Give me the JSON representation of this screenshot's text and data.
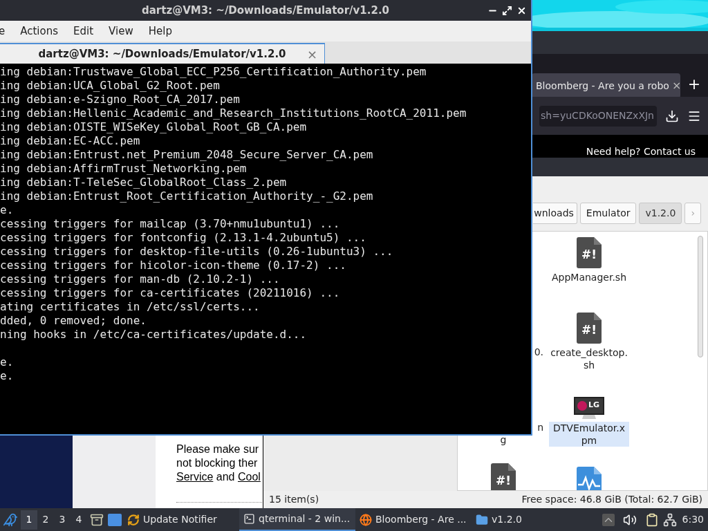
{
  "terminal": {
    "title": "dartz@VM3: ~/Downloads/Emulator/v1.2.0",
    "menu": [
      "e",
      "Actions",
      "Edit",
      "View",
      "Help"
    ],
    "tabs": [
      {
        "label": "dartz@VM3: ~/Downloads/Emulator/v1.2.0",
        "selected": true,
        "close": "×"
      }
    ],
    "blocks": [
      [
        "ing debian:Trustwave_Global_ECC_P256_Certification_Authority.pem",
        "ing debian:UCA_Global_G2_Root.pem",
        "ing debian:e-Szigno_Root_CA_2017.pem",
        "ing debian:Hellenic_Academic_and_Research_Institutions_RootCA_2011.pem",
        "ing debian:OISTE_WISeKey_Global_Root_GB_CA.pem",
        "ing debian:EC-ACC.pem",
        "ing debian:Entrust.net_Premium_2048_Secure_Server_CA.pem",
        "ing debian:AffirmTrust_Networking.pem",
        "ing debian:T-TeleSec_GlobalRoot_Class_2.pem",
        "ing debian:Entrust_Root_Certification_Authority_-_G2.pem",
        "e.",
        "cessing triggers for mailcap (3.70+nmu1ubuntu1) ...",
        "cessing triggers for fontconfig (2.13.1-4.2ubuntu5) ...",
        "cessing triggers for desktop-file-utils (0.26-1ubuntu3) ...",
        "cessing triggers for hicolor-icon-theme (0.17-2) ...",
        "cessing triggers for man-db (2.10.2-1) ...",
        "cessing triggers for ca-certificates (20211016) ...",
        "ating certificates in /etc/ssl/certs...",
        "dded, 0 removed; done.",
        "ning hooks in /etc/ca-certificates/update.d..."
      ],
      [
        "e.",
        "e."
      ]
    ]
  },
  "browser": {
    "tab": {
      "label": "Bloomberg - Are you a robo",
      "close": "×"
    },
    "new_tab": "+",
    "url": "sh=yuCDKoONENZxXJn",
    "banner": "Need help? Contact us",
    "page_lines": [
      [
        {
          "text": "Please make sur",
          "link": false
        }
      ],
      [
        {
          "text": "not blocking ther",
          "link": false
        }
      ],
      [
        {
          "text": "Service",
          "link": true
        },
        {
          "text": " and ",
          "link": false
        },
        {
          "text": "Cool",
          "link": true
        }
      ]
    ]
  },
  "file_manager": {
    "breadcrumbs": [
      {
        "label": "wnloads",
        "selected": false
      },
      {
        "label": "Emulator",
        "selected": false
      },
      {
        "label": "v1.2.0",
        "selected": true
      },
      {
        "label": "›",
        "selected": false
      }
    ],
    "rows": [
      {
        "right": {
          "kind": "script",
          "glyph": "#!",
          "label": "AppManager.sh",
          "selected": false
        }
      },
      {
        "left": {
          "label_lines": [
            "0."
          ]
        },
        "right": {
          "kind": "script",
          "glyph": "#!",
          "label": "create_desktop.sh",
          "selected": false
        }
      },
      {
        "left": {
          "label_lines": [
            "n",
            "g"
          ]
        },
        "right": {
          "kind": "tv",
          "logo": "LG",
          "label": "DTVEmulator.xpm",
          "selected": true
        }
      },
      {
        "left": {
          "kind": "script",
          "glyph": "#!"
        },
        "right": {
          "kind": "waveform"
        }
      }
    ],
    "item_count": "15 item(s)",
    "free_space": "Free space: 46.8 GiB (Total: 62.7 GiB)"
  },
  "taskbar": {
    "workspaces": [
      {
        "label": "1",
        "selected": true
      },
      {
        "label": "2",
        "selected": false
      },
      {
        "label": "3",
        "selected": false
      },
      {
        "label": "4",
        "selected": false
      }
    ],
    "tasks": [
      {
        "label": "Update Notifier",
        "kind": "update",
        "selected": false
      },
      {
        "label": "qterminal - 2 win...",
        "kind": "terminal",
        "selected": true
      },
      {
        "label": "Bloomberg - Are ...",
        "kind": "browser",
        "selected": false
      },
      {
        "label": "v1.2.0",
        "kind": "folder",
        "selected": false
      }
    ],
    "clock": "6:30"
  }
}
